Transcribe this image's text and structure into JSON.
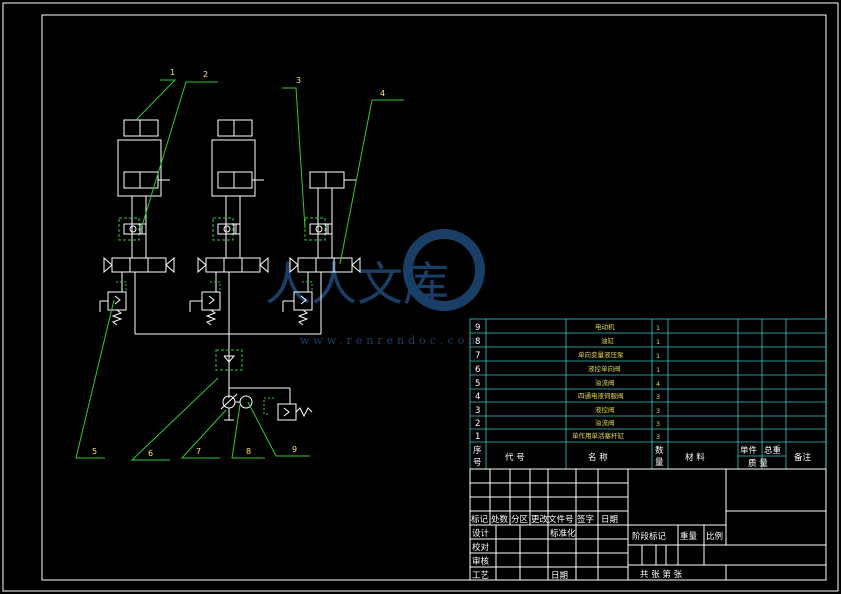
{
  "balloons": [
    "1",
    "2",
    "3",
    "4",
    "5",
    "6",
    "7",
    "8",
    "9"
  ],
  "watermark": {
    "text": "人人文库",
    "url": "www.renrendoc.com"
  },
  "bom": {
    "rows": [
      {
        "no": "9",
        "name": "电动机",
        "qty": "1"
      },
      {
        "no": "8",
        "name": "油缸",
        "qty": "1"
      },
      {
        "no": "7",
        "name": "单向变量液压泵",
        "qty": "1"
      },
      {
        "no": "6",
        "name": "液控单向阀",
        "qty": "1"
      },
      {
        "no": "5",
        "name": "溢流阀",
        "qty": "4"
      },
      {
        "no": "4",
        "name": "四通电液伺服阀",
        "qty": "3"
      },
      {
        "no": "3",
        "name": "液控阀",
        "qty": "3"
      },
      {
        "no": "2",
        "name": "溢流阀",
        "qty": "3"
      },
      {
        "no": "1",
        "name": "单作用单活塞杆缸",
        "qty": "3"
      }
    ],
    "header": {
      "seq_top": "序",
      "seq_bot": "号",
      "code": "代  号",
      "name": "名  称",
      "qty_top": "数",
      "qty_bot": "量",
      "material": "材  料",
      "unit_wt": "单件",
      "total_wt": "总重",
      "weight": "质 量",
      "remark": "备注"
    }
  },
  "title_block": {
    "mark_row": [
      "标记",
      "处数",
      "分区",
      "更改文件号",
      "签字",
      "日期"
    ],
    "design": "设计",
    "standard": "标准化",
    "check": "校对",
    "review": "审核",
    "process": "工艺",
    "date": "日期",
    "stage": "阶段标记",
    "weight": "重量",
    "scale": "比例",
    "sheets": "共   张  第   张"
  }
}
